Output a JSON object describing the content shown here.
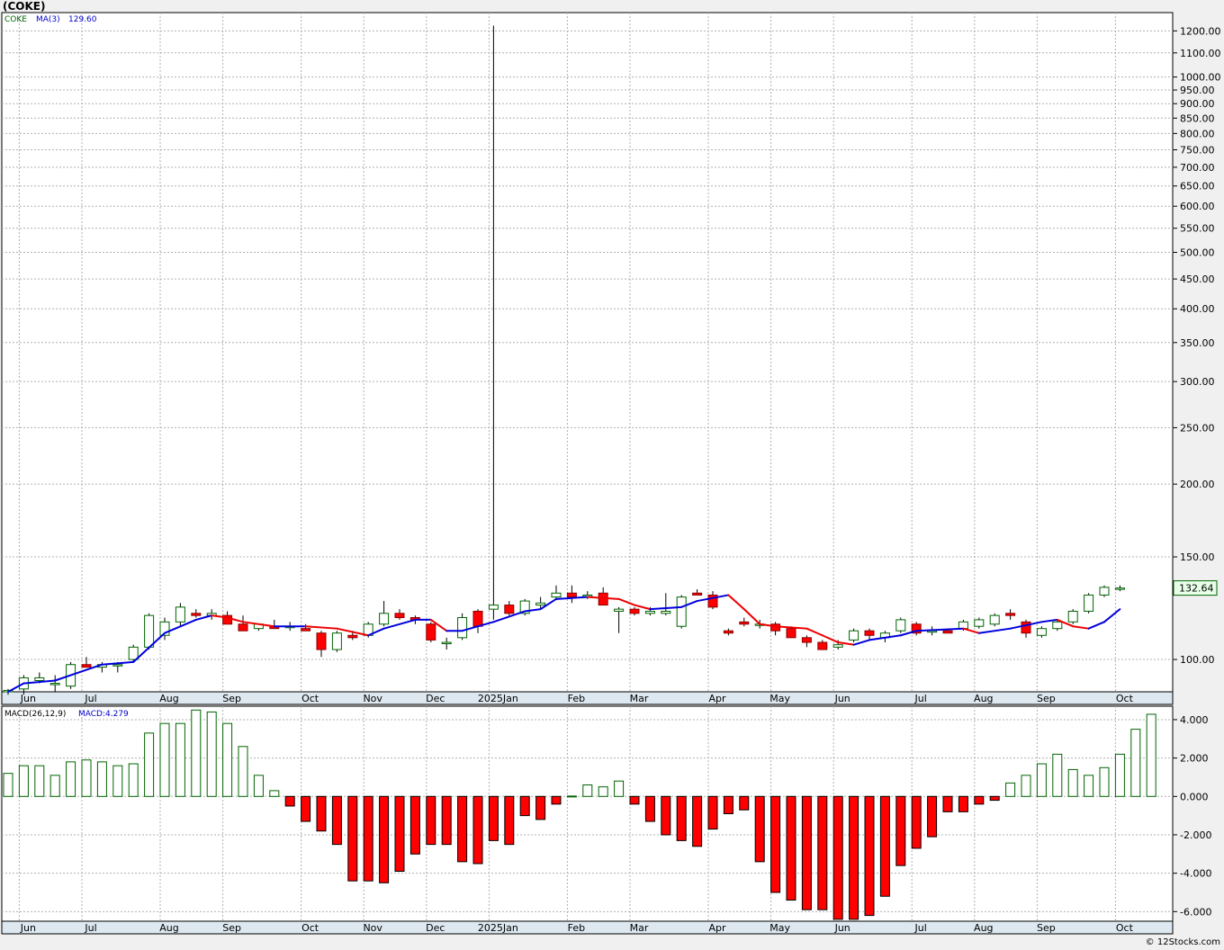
{
  "title": "(COKE)",
  "credit": "© 12Stocks.com",
  "chart_data": [
    {
      "type": "candlestick",
      "symbol": "COKE",
      "scale": "log",
      "ylim": [
        88,
        1290
      ],
      "grid": true,
      "legend": {
        "symbol_label": "COKE",
        "ma_label": "MA(3)",
        "ma_value": "129.60"
      },
      "last_price_label": "132.64",
      "y_ticks": [
        "100.00",
        "150.00",
        "200.00",
        "250.00",
        "300.00",
        "350.00",
        "400.00",
        "450.00",
        "500.00",
        "550.00",
        "600.00",
        "650.00",
        "700.00",
        "750.00",
        "800.00",
        "850.00",
        "900.00",
        "950.00",
        "1000.00",
        "1100.00",
        "1200.00"
      ],
      "x_labels": [
        {
          "label": "Jun",
          "i": 1
        },
        {
          "label": "Jul",
          "i": 5
        },
        {
          "label": "Aug",
          "i": 10
        },
        {
          "label": "Sep",
          "i": 14
        },
        {
          "label": "Oct",
          "i": 19
        },
        {
          "label": "Nov",
          "i": 23
        },
        {
          "label": "Dec",
          "i": 27
        },
        {
          "label": "2025Jan",
          "i": 31
        },
        {
          "label": "Feb",
          "i": 36
        },
        {
          "label": "Mar",
          "i": 40
        },
        {
          "label": "Apr",
          "i": 45
        },
        {
          "label": "May",
          "i": 49
        },
        {
          "label": "Jun",
          "i": 53
        },
        {
          "label": "Jul",
          "i": 58
        },
        {
          "label": "Aug",
          "i": 62
        },
        {
          "label": "Sep",
          "i": 66
        },
        {
          "label": "Oct",
          "i": 71
        }
      ],
      "colors": {
        "up_fill": "#ffffff",
        "up_stroke": "#006400",
        "down_fill": "#ff0000",
        "down_stroke": "#8b0000",
        "ma_up": "#0000dd",
        "ma_down": "#ee0000"
      },
      "candles": [
        [
          88,
          89,
          87,
          88.5
        ],
        [
          89,
          94,
          87,
          93
        ],
        [
          92,
          95,
          91,
          93
        ],
        [
          91,
          94,
          88,
          91
        ],
        [
          90,
          99,
          89,
          98
        ],
        [
          98,
          101,
          97,
          97
        ],
        [
          97,
          99,
          95,
          98
        ],
        [
          98,
          99,
          95,
          98
        ],
        [
          100,
          106,
          99,
          105
        ],
        [
          105,
          120,
          104,
          119
        ],
        [
          110,
          118,
          108,
          116
        ],
        [
          116,
          125,
          114,
          123
        ],
        [
          120,
          122,
          118,
          119
        ],
        [
          119,
          122,
          117,
          120
        ],
        [
          119,
          121,
          115,
          115
        ],
        [
          115,
          119,
          112,
          112
        ],
        [
          113,
          115,
          112,
          115
        ],
        [
          114,
          117,
          113,
          113
        ],
        [
          114,
          116,
          112,
          114
        ],
        [
          113,
          115,
          112,
          112
        ],
        [
          111,
          112,
          101,
          104
        ],
        [
          104,
          112,
          103,
          111
        ],
        [
          110,
          112,
          108,
          109
        ],
        [
          110,
          116,
          109,
          115
        ],
        [
          115,
          126,
          114,
          120
        ],
        [
          120,
          122,
          117,
          118
        ],
        [
          118,
          119,
          115,
          117
        ],
        [
          115,
          116,
          107,
          108
        ],
        [
          107,
          109,
          104,
          107
        ],
        [
          109,
          120,
          108,
          118
        ],
        [
          121,
          122,
          111,
          114
        ],
        [
          122,
          1225,
          117,
          124
        ],
        [
          124,
          126,
          119,
          120
        ],
        [
          120,
          127,
          119,
          126
        ],
        [
          124,
          128,
          122,
          125
        ],
        [
          128,
          134,
          127,
          130
        ],
        [
          130,
          134,
          125,
          128
        ],
        [
          129,
          131,
          127,
          129
        ],
        [
          130,
          133,
          124,
          124
        ],
        [
          121,
          123,
          111,
          122
        ],
        [
          122,
          123,
          119,
          120
        ],
        [
          120,
          123,
          119,
          121
        ],
        [
          120,
          130,
          119,
          121
        ],
        [
          114,
          129,
          113,
          128
        ],
        [
          130,
          132,
          129,
          129
        ],
        [
          129,
          131,
          122,
          123
        ],
        [
          112,
          113,
          110,
          111
        ],
        [
          116,
          118,
          114,
          115
        ],
        [
          115,
          117,
          113,
          115
        ],
        [
          115,
          116,
          110,
          112
        ],
        [
          113,
          114,
          109,
          109
        ],
        [
          109,
          110,
          105,
          107
        ],
        [
          107,
          108,
          104,
          104
        ],
        [
          105,
          108,
          104,
          106
        ],
        [
          108,
          113,
          107,
          112
        ],
        [
          112,
          113,
          108,
          110
        ],
        [
          109,
          112,
          107,
          111
        ],
        [
          112,
          118,
          111,
          117
        ],
        [
          115,
          116,
          110,
          111
        ],
        [
          112,
          114,
          110,
          112
        ],
        [
          112,
          113,
          111,
          111
        ],
        [
          113,
          117,
          112,
          116
        ],
        [
          114,
          118,
          113,
          117
        ],
        [
          115,
          120,
          114,
          119
        ],
        [
          120,
          122,
          117,
          119
        ],
        [
          116,
          117,
          109,
          111
        ],
        [
          110,
          114,
          109,
          113
        ],
        [
          113,
          117,
          112,
          116
        ],
        [
          116,
          122,
          115,
          121
        ],
        [
          121,
          130,
          120,
          129
        ],
        [
          129,
          134,
          128,
          133
        ],
        [
          132,
          134,
          131,
          132.64
        ]
      ],
      "ma": [
        {
          "i": 0,
          "v": 88
        },
        {
          "i": 1,
          "v": 91
        },
        {
          "i": 3,
          "v": 92
        },
        {
          "i": 5,
          "v": 96
        },
        {
          "i": 6,
          "v": 98
        },
        {
          "i": 8,
          "v": 99
        },
        {
          "i": 10,
          "v": 111
        },
        {
          "i": 12,
          "v": 117
        },
        {
          "i": 13,
          "v": 119
        },
        {
          "i": 14,
          "v": 118
        },
        {
          "i": 15,
          "v": 116
        },
        {
          "i": 17,
          "v": 114
        },
        {
          "i": 19,
          "v": 114
        },
        {
          "i": 21,
          "v": 113
        },
        {
          "i": 23,
          "v": 110
        },
        {
          "i": 24,
          "v": 113
        },
        {
          "i": 26,
          "v": 117
        },
        {
          "i": 27,
          "v": 117
        },
        {
          "i": 28,
          "v": 112
        },
        {
          "i": 29,
          "v": 112
        },
        {
          "i": 30,
          "v": 114
        },
        {
          "i": 31,
          "v": 116
        },
        {
          "i": 33,
          "v": 121
        },
        {
          "i": 34,
          "v": 122
        },
        {
          "i": 35,
          "v": 127
        },
        {
          "i": 37,
          "v": 128
        },
        {
          "i": 39,
          "v": 127
        },
        {
          "i": 40,
          "v": 124
        },
        {
          "i": 41,
          "v": 122
        },
        {
          "i": 43,
          "v": 123
        },
        {
          "i": 44,
          "v": 126
        },
        {
          "i": 46,
          "v": 129
        },
        {
          "i": 47,
          "v": 122
        },
        {
          "i": 48,
          "v": 115
        },
        {
          "i": 49,
          "v": 114
        },
        {
          "i": 51,
          "v": 113
        },
        {
          "i": 52,
          "v": 110
        },
        {
          "i": 53,
          "v": 107
        },
        {
          "i": 54,
          "v": 106
        },
        {
          "i": 55,
          "v": 108
        },
        {
          "i": 57,
          "v": 110
        },
        {
          "i": 58,
          "v": 112
        },
        {
          "i": 61,
          "v": 113
        },
        {
          "i": 62,
          "v": 111
        },
        {
          "i": 64,
          "v": 113
        },
        {
          "i": 66,
          "v": 116
        },
        {
          "i": 67,
          "v": 117
        },
        {
          "i": 68,
          "v": 114
        },
        {
          "i": 69,
          "v": 113
        },
        {
          "i": 70,
          "v": 116
        },
        {
          "i": 71,
          "v": 122
        }
      ]
    },
    {
      "type": "bar",
      "name": "MACD(26,12,9)",
      "legend": {
        "label": "MACD(26,12,9)",
        "value_label": "MACD:4.279"
      },
      "ylim": [
        -6.5,
        4.7
      ],
      "y_ticks": [
        "4.000",
        "2.000",
        "0.000",
        "-2.000",
        "-4.000",
        "-6.000"
      ],
      "colors": {
        "positive_stroke": "#006400",
        "negative_fill": "#ff0000"
      },
      "values": [
        1.2,
        1.6,
        1.6,
        1.1,
        1.8,
        1.9,
        1.8,
        1.6,
        1.7,
        3.3,
        3.8,
        3.8,
        4.5,
        4.4,
        3.8,
        2.6,
        1.1,
        0.3,
        -0.5,
        -1.3,
        -1.8,
        -2.5,
        -4.4,
        -4.4,
        -4.5,
        -3.9,
        -3.0,
        -2.5,
        -2.5,
        -3.4,
        -3.5,
        -2.3,
        -2.5,
        -1.0,
        -1.2,
        -0.4,
        0.02,
        0.6,
        0.5,
        0.8,
        -0.4,
        -1.3,
        -2.0,
        -2.3,
        -2.6,
        -1.7,
        -0.9,
        -0.7,
        -3.4,
        -5.0,
        -5.4,
        -5.9,
        -5.9,
        -6.4,
        -6.4,
        -6.2,
        -5.2,
        -3.6,
        -2.7,
        -2.1,
        -0.8,
        -0.8,
        -0.4,
        -0.2,
        0.7,
        1.1,
        1.7,
        2.2,
        1.4,
        1.1,
        1.5,
        2.2,
        3.5,
        4.279
      ],
      "x_labels": [
        {
          "label": "Jun",
          "i": 1
        },
        {
          "label": "Jul",
          "i": 5
        },
        {
          "label": "Aug",
          "i": 10
        },
        {
          "label": "Sep",
          "i": 14
        },
        {
          "label": "Oct",
          "i": 19
        },
        {
          "label": "Nov",
          "i": 23
        },
        {
          "label": "Dec",
          "i": 27
        },
        {
          "label": "2025Jan",
          "i": 31
        },
        {
          "label": "Feb",
          "i": 36
        },
        {
          "label": "Mar",
          "i": 40
        },
        {
          "label": "Apr",
          "i": 45
        },
        {
          "label": "May",
          "i": 49
        },
        {
          "label": "Jun",
          "i": 53
        },
        {
          "label": "Jul",
          "i": 58
        },
        {
          "label": "Aug",
          "i": 62
        },
        {
          "label": "Sep",
          "i": 66
        },
        {
          "label": "Oct",
          "i": 71
        }
      ]
    }
  ]
}
